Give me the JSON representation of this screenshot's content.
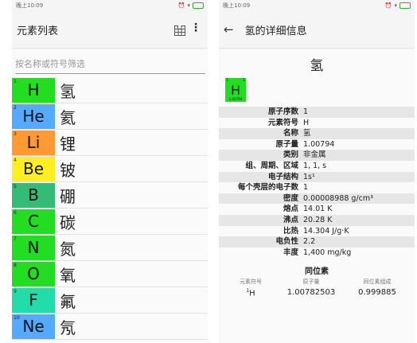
{
  "status": {
    "time": "晚上10:09"
  },
  "list_screen": {
    "title": "元素列表",
    "filter_placeholder": "按名称或符号筛选",
    "elements": [
      {
        "number": "1",
        "symbol": "H",
        "name": "氢",
        "color": "#22dd22"
      },
      {
        "number": "2",
        "symbol": "He",
        "name": "氦",
        "color": "#55aaff"
      },
      {
        "number": "3",
        "symbol": "Li",
        "name": "锂",
        "color": "#ff9933"
      },
      {
        "number": "4",
        "symbol": "Be",
        "name": "铍",
        "color": "#ffee22"
      },
      {
        "number": "5",
        "symbol": "B",
        "name": "硼",
        "color": "#33bb77"
      },
      {
        "number": "6",
        "symbol": "C",
        "name": "碳",
        "color": "#22dd22"
      },
      {
        "number": "7",
        "symbol": "N",
        "name": "氮",
        "color": "#22dd22"
      },
      {
        "number": "8",
        "symbol": "O",
        "name": "氧",
        "color": "#22dd22"
      },
      {
        "number": "9",
        "symbol": "F",
        "name": "氟",
        "color": "#22ddaa"
      },
      {
        "number": "10",
        "symbol": "Ne",
        "name": "氖",
        "color": "#55aaff"
      }
    ]
  },
  "detail_screen": {
    "title": "氢的详细信息",
    "element_name": "氢",
    "tile": {
      "number": "1",
      "number_right": "1",
      "symbol": "H",
      "mass": "1.00794",
      "color": "#22dd22"
    },
    "properties": [
      {
        "label": "原子序数",
        "value": "1"
      },
      {
        "label": "元素符号",
        "value": "H"
      },
      {
        "label": "名称",
        "value": "氢"
      },
      {
        "label": "原子量",
        "value": "1.00794"
      },
      {
        "label": "类别",
        "value": "非金属"
      },
      {
        "label": "组、周期、区域",
        "value": "1, 1, s"
      },
      {
        "label": "电子结构",
        "value": "1s¹"
      },
      {
        "label": "每个壳层的电子数",
        "value": "1"
      },
      {
        "label": "密度",
        "value": "0.00008988 g/cm³"
      },
      {
        "label": "熔点",
        "value": "14.01 K"
      },
      {
        "label": "沸点",
        "value": "20.28 K"
      },
      {
        "label": "比热",
        "value": "14.304 J/g·K"
      },
      {
        "label": "电负性",
        "value": "2.2"
      },
      {
        "label": "丰度",
        "value": "1,400 mg/kg"
      }
    ],
    "isotopes": {
      "title": "同位素",
      "headers": [
        "元素符号",
        "原子量",
        "同位素组成"
      ],
      "rows": [
        {
          "mass_number": "1",
          "symbol": "H",
          "mass": "1.00782503",
          "composition": "0.999885"
        }
      ]
    }
  }
}
